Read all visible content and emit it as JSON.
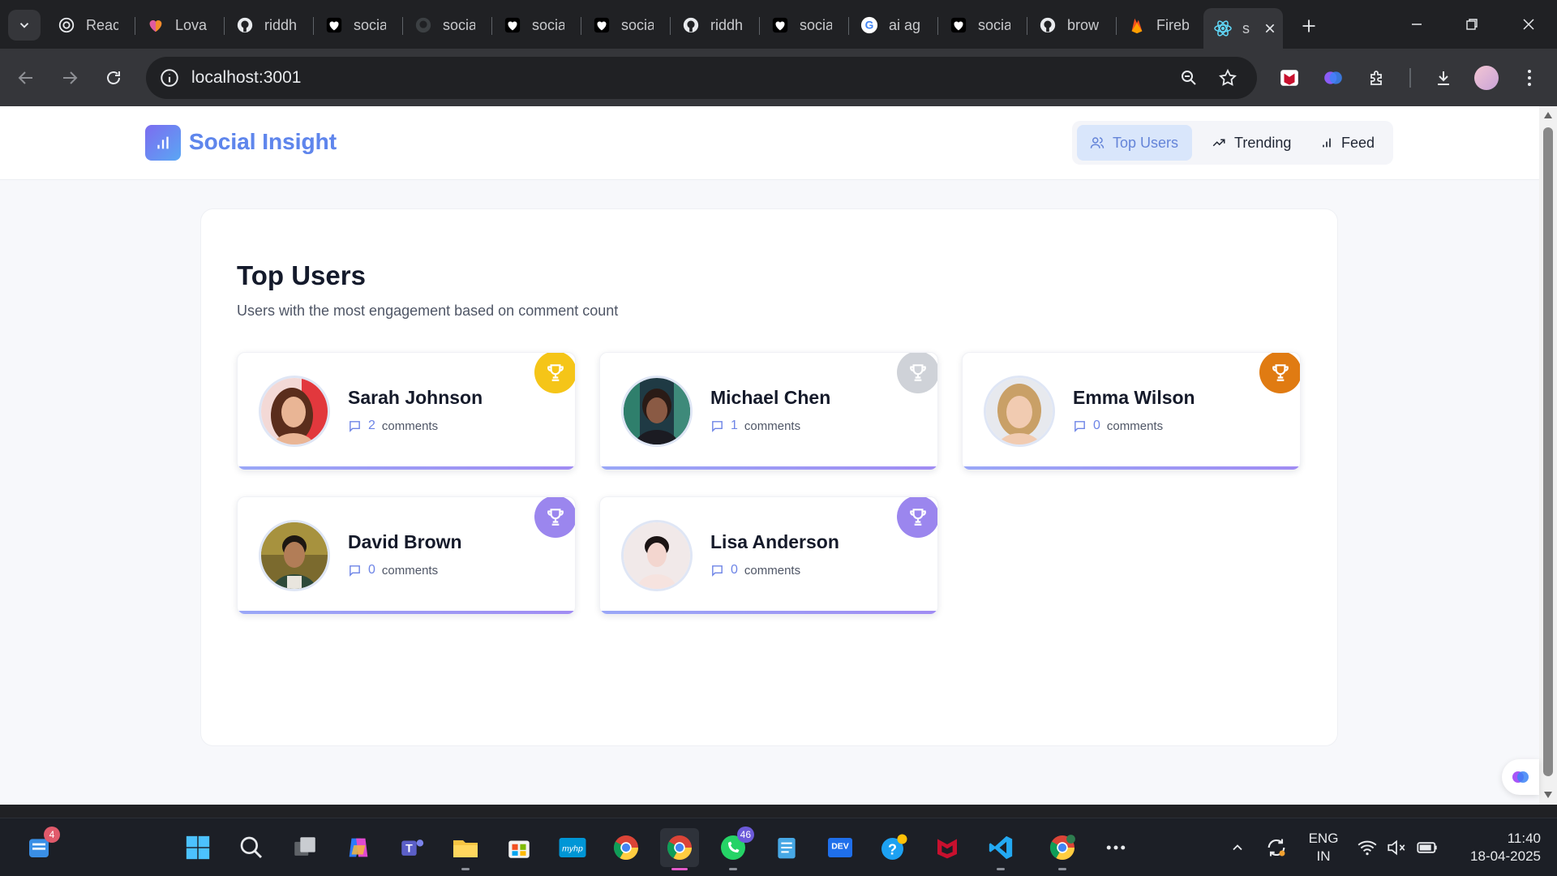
{
  "browser": {
    "tabs": [
      {
        "title": "Reac",
        "icon": "openai-icon"
      },
      {
        "title": "Lova",
        "icon": "lovable-heart-icon"
      },
      {
        "title": "riddh",
        "icon": "github-icon"
      },
      {
        "title": "socia",
        "icon": "heart-icon"
      },
      {
        "title": "socia",
        "icon": "github-icon"
      },
      {
        "title": "socia",
        "icon": "heart-icon"
      },
      {
        "title": "socia",
        "icon": "heart-icon"
      },
      {
        "title": "riddh",
        "icon": "github-icon"
      },
      {
        "title": "socia",
        "icon": "heart-icon"
      },
      {
        "title": "ai ag",
        "icon": "google-icon"
      },
      {
        "title": "socia",
        "icon": "heart-icon"
      },
      {
        "title": "brow",
        "icon": "github-icon"
      },
      {
        "title": "Fireb",
        "icon": "firebase-icon"
      },
      {
        "title": "s",
        "icon": "react-icon"
      }
    ],
    "url": "localhost:3001"
  },
  "app": {
    "brand": "Social Insight",
    "nav": [
      {
        "label": "Top Users",
        "icon": "users-icon",
        "active": true
      },
      {
        "label": "Trending",
        "icon": "trending-up-icon",
        "active": false
      },
      {
        "label": "Feed",
        "icon": "bar-chart-icon",
        "active": false
      }
    ],
    "page": {
      "title": "Top Users",
      "subtitle": "Users with the most engagement based on comment count"
    },
    "comments_word": "comments",
    "users": [
      {
        "name": "Sarah Johnson",
        "comments": "2",
        "trophy_color": "#f5c518"
      },
      {
        "name": "Michael Chen",
        "comments": "1",
        "trophy_color": "#cfd2d8"
      },
      {
        "name": "Emma Wilson",
        "comments": "0",
        "trophy_color": "#e07b12"
      },
      {
        "name": "David Brown",
        "comments": "0",
        "trophy_color": "#9b86ee"
      },
      {
        "name": "Lisa Anderson",
        "comments": "0",
        "trophy_color": "#9b86ee"
      }
    ]
  },
  "taskbar": {
    "widgets_badge": "4",
    "whatsapp_badge": "46",
    "language": "ENG",
    "region": "IN",
    "time": "11:40",
    "date": "18-04-2025"
  },
  "colors": {
    "accent": "#6d84e6",
    "active_nav_bg": "#d9e6fb"
  }
}
